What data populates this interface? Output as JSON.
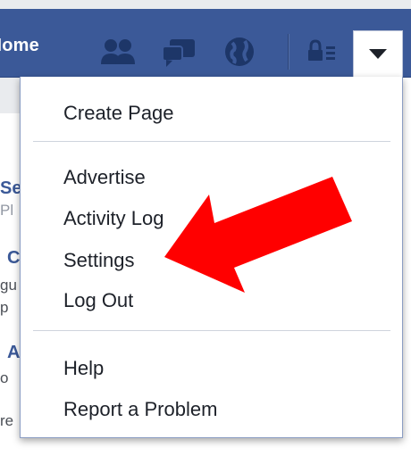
{
  "header": {
    "home_label": "Home",
    "icons": {
      "friends": "friend-requests-icon",
      "messages": "messages-icon",
      "notifications": "notifications-globe-icon",
      "privacy": "privacy-shortcuts-icon",
      "menu": "chevron-down-icon"
    }
  },
  "background_fragments": {
    "line1": "Se",
    "line2": "Pl",
    "line3": "C",
    "line4": "gu",
    "line5": "p",
    "line6": "A",
    "line7": "o",
    "line8": "re"
  },
  "dropdown": {
    "groups": [
      {
        "items": [
          "Create Page"
        ]
      },
      {
        "items": [
          "Advertise",
          "Activity Log",
          "Settings",
          "Log Out"
        ]
      },
      {
        "items": [
          "Help",
          "Report a Problem"
        ]
      }
    ]
  },
  "colors": {
    "header_blue": "#3b5998",
    "annotation_red": "#ff0000",
    "menu_text": "#1d2129"
  },
  "annotation": {
    "type": "arrow",
    "points_to": "Settings"
  }
}
